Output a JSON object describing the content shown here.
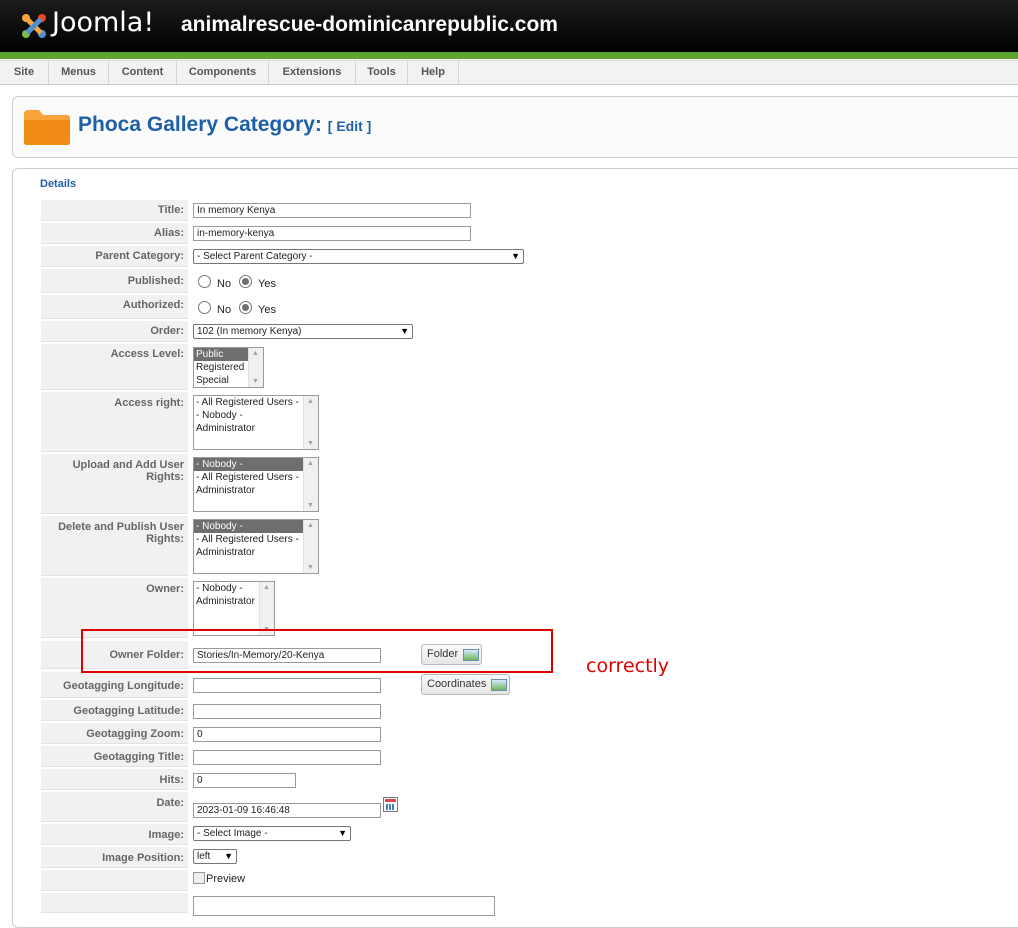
{
  "header": {
    "logo_text": "Joomla!",
    "site_name": "animalrescue-dominicanrepublic.com"
  },
  "menu": [
    "Site",
    "Menus",
    "Content",
    "Components",
    "Extensions",
    "Tools",
    "Help"
  ],
  "page": {
    "title": "Phoca Gallery Category:",
    "subtitle": "[ Edit ]"
  },
  "details": {
    "legend": "Details",
    "title_label": "Title:",
    "title_value": "In memory Kenya",
    "alias_label": "Alias:",
    "alias_value": "in-memory-kenya",
    "parent_label": "Parent Category:",
    "parent_value": "- Select Parent Category -",
    "published_label": "Published:",
    "authorized_label": "Authorized:",
    "no": "No",
    "yes": "Yes",
    "order_label": "Order:",
    "order_value": "102 (In memory Kenya)",
    "access_level_label": "Access Level:",
    "access_level_options": [
      "Public",
      "Registered",
      "Special"
    ],
    "access_right_label": "Access right:",
    "access_right_options": [
      "- All Registered Users -",
      "- Nobody -",
      "Administrator"
    ],
    "upload_label_1": "Upload and Add User",
    "upload_label_2": "Rights:",
    "upload_options": [
      "- Nobody -",
      "- All Registered Users -",
      "Administrator"
    ],
    "delete_label_1": "Delete and Publish User",
    "delete_label_2": "Rights:",
    "delete_options": [
      "- Nobody -",
      "- All Registered Users -",
      "Administrator"
    ],
    "owner_label": "Owner:",
    "owner_options": [
      "- Nobody -",
      "Administrator"
    ],
    "owner_folder_label": "Owner Folder:",
    "owner_folder_value": "Stories/In-Memory/20-Kenya",
    "folder_button": "Folder",
    "geo_long_label": "Geotagging Longitude:",
    "coordinates_button": "Coordinates",
    "geo_lat_label": "Geotagging Latitude:",
    "geo_zoom_label": "Geotagging Zoom:",
    "geo_zoom_value": "0",
    "geo_title_label": "Geotagging Title:",
    "hits_label": "Hits:",
    "hits_value": "0",
    "date_label": "Date:",
    "date_value": "2023-01-09 16:46:48",
    "image_label": "Image:",
    "image_value": "- Select Image -",
    "image_position_label": "Image Position:",
    "image_position_value": "left",
    "preview_text": "Preview"
  },
  "annotation": {
    "text": "correctly",
    "color": "#e00000"
  },
  "colors": {
    "title_blue": "#1f5fa8",
    "accent_green": "#5ea32d"
  }
}
